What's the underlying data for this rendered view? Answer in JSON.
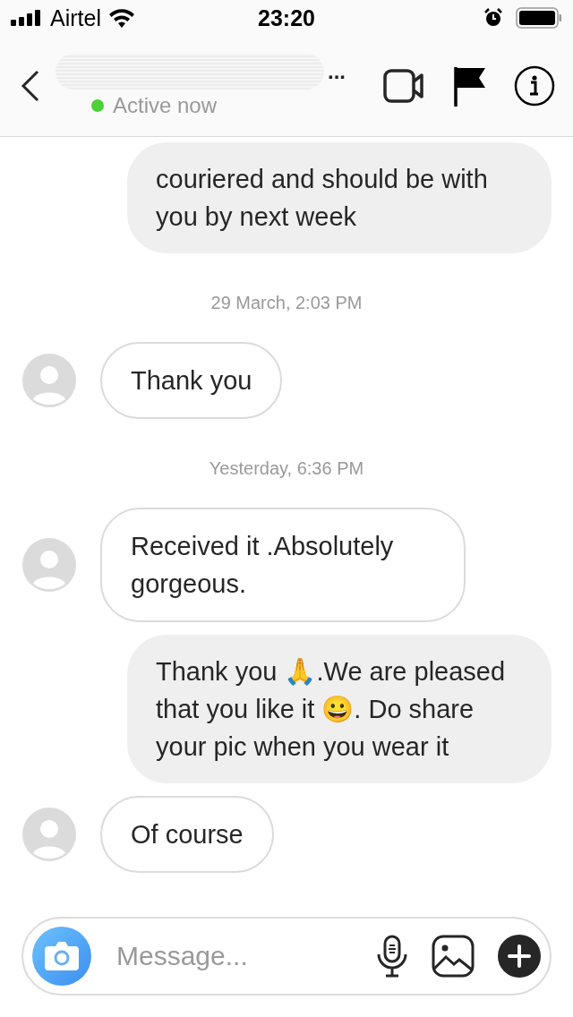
{
  "status_bar": {
    "carrier": "Airtel",
    "time": "23:20"
  },
  "header": {
    "name_ellipsis": "...",
    "presence": "Active now",
    "online": true
  },
  "messages": [
    {
      "kind": "outgoing",
      "text": "couriered and should be with you by next week"
    },
    {
      "kind": "timestamp",
      "text": "29 March, 2:03 PM"
    },
    {
      "kind": "incoming",
      "text": "Thank you"
    },
    {
      "kind": "timestamp",
      "text": "Yesterday, 6:36 PM"
    },
    {
      "kind": "incoming",
      "text": "Received it .Absolutely gorgeous."
    },
    {
      "kind": "outgoing",
      "text": "Thank you 🙏.We are pleased that you like it 😀. Do share your pic when you wear it"
    },
    {
      "kind": "incoming",
      "text": "Of course"
    }
  ],
  "composer": {
    "placeholder": "Message..."
  }
}
